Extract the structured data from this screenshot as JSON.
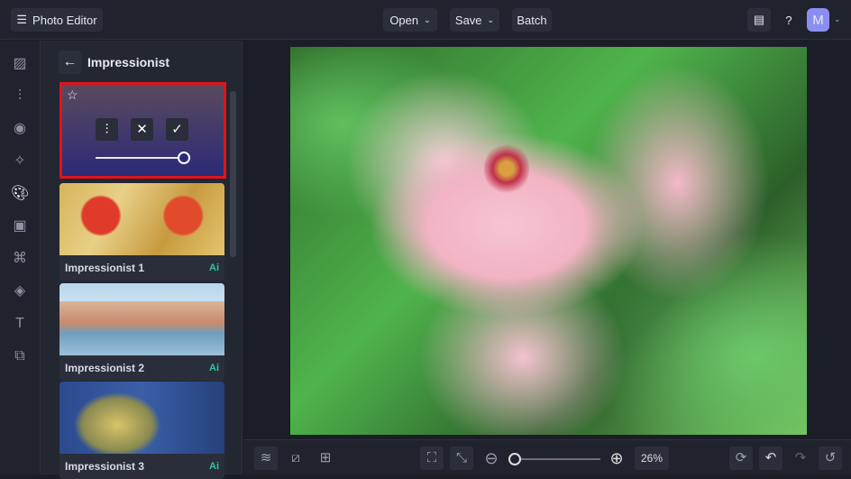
{
  "header": {
    "menu_label": "Photo Editor",
    "open": "Open",
    "save": "Save",
    "batch": "Batch",
    "avatar": "M"
  },
  "panel": {
    "title": "Impressionist",
    "items": [
      {
        "label": "Impressionist 1",
        "badge": "Ai"
      },
      {
        "label": "Impressionist 2",
        "badge": "Ai"
      },
      {
        "label": "Impressionist 3",
        "badge": "Ai"
      }
    ],
    "intensity": 1.0
  },
  "zoom": {
    "value": "26%",
    "slider": 0.02
  },
  "colors": {
    "selection": "#e0141a",
    "ai": "#2fc6a0"
  }
}
